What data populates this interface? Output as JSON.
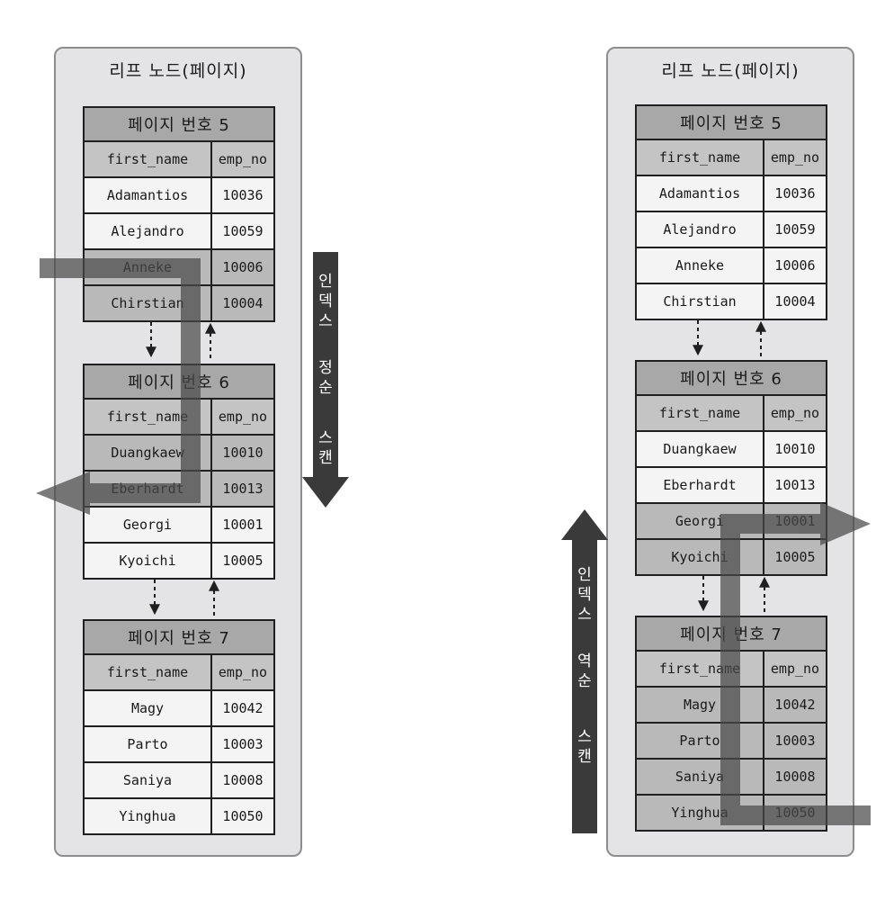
{
  "panels": [
    {
      "title": "리프 노드(페이지)",
      "pages": [
        {
          "header": "페이지 번호 5",
          "columns": [
            "first_name",
            "emp_no"
          ],
          "rows": [
            [
              "Adamantios",
              "10036"
            ],
            [
              "Alejandro",
              "10059"
            ],
            [
              "Anneke",
              "10006"
            ],
            [
              "Chirstian",
              "10004"
            ]
          ]
        },
        {
          "header": "페이지 번호 6",
          "columns": [
            "first_name",
            "emp_no"
          ],
          "rows": [
            [
              "Duangkaew",
              "10010"
            ],
            [
              "Eberhardt",
              "10013"
            ],
            [
              "Georgi",
              "10001"
            ],
            [
              "Kyoichi",
              "10005"
            ]
          ]
        },
        {
          "header": "페이지 번호 7",
          "columns": [
            "first_name",
            "emp_no"
          ],
          "rows": [
            [
              "Magy",
              "10042"
            ],
            [
              "Parto",
              "10003"
            ],
            [
              "Saniya",
              "10008"
            ],
            [
              "Yinghua",
              "10050"
            ]
          ]
        }
      ]
    },
    {
      "title": "리프 노드(페이지)",
      "pages": [
        {
          "header": "페이지 번호 5",
          "columns": [
            "first_name",
            "emp_no"
          ],
          "rows": [
            [
              "Adamantios",
              "10036"
            ],
            [
              "Alejandro",
              "10059"
            ],
            [
              "Anneke",
              "10006"
            ],
            [
              "Chirstian",
              "10004"
            ]
          ]
        },
        {
          "header": "페이지 번호 6",
          "columns": [
            "first_name",
            "emp_no"
          ],
          "rows": [
            [
              "Duangkaew",
              "10010"
            ],
            [
              "Eberhardt",
              "10013"
            ],
            [
              "Georgi",
              "10001"
            ],
            [
              "Kyoichi",
              "10005"
            ]
          ]
        },
        {
          "header": "페이지 번호 7",
          "columns": [
            "first_name",
            "emp_no"
          ],
          "rows": [
            [
              "Magy",
              "10042"
            ],
            [
              "Parto",
              "10003"
            ],
            [
              "Saniya",
              "10008"
            ],
            [
              "Yinghua",
              "10050"
            ]
          ]
        }
      ]
    }
  ],
  "scan_labels": {
    "forward": [
      "인",
      "덱",
      "스",
      "정",
      "순",
      "스",
      "캔"
    ],
    "backward": [
      "인",
      "덱",
      "스",
      "역",
      "순",
      "스",
      "캔"
    ]
  },
  "colors": {
    "scan_arrow": "#3a3a3a",
    "scan_path": "#555555",
    "page_header": "#a8a8a8",
    "panel_bg": "#e4e4e6"
  }
}
